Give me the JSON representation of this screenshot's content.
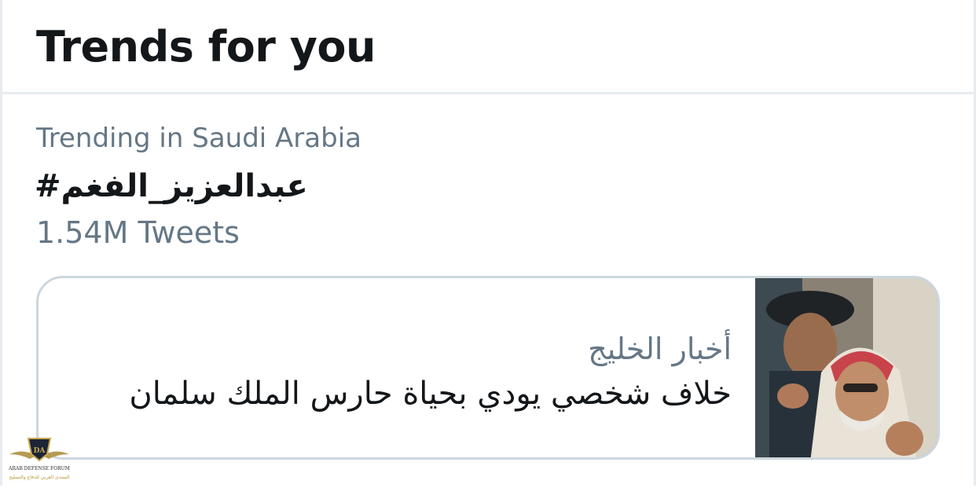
{
  "header": {
    "title": "Trends for you"
  },
  "trend": {
    "context": "Trending in Saudi Arabia",
    "name": "#عبدالعزيز_الفغم",
    "count": "1.54M Tweets"
  },
  "card": {
    "source": "أخبار الخليج",
    "headline": "خلاف شخصي يودي بحياة حارس الملك سلمان"
  },
  "watermark": {
    "line1": "ARAB DEFENSE FORUM",
    "line2": "المنتدى العربي للدفاع والتسليح"
  }
}
